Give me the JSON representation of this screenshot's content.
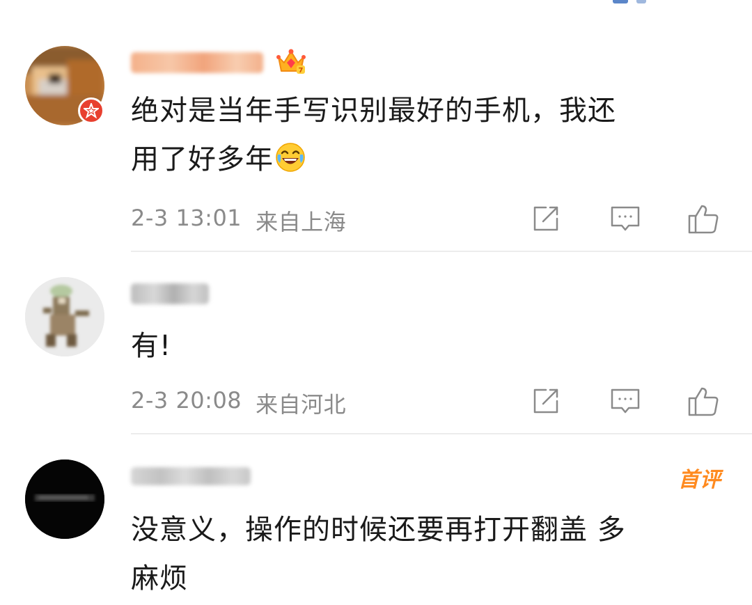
{
  "colors": {
    "text_primary": "#1a1a1a",
    "text_secondary": "#8a8a8a",
    "vip_red": "#e8402f",
    "first_comment_tag": "#ff8a1f",
    "divider": "#ececec"
  },
  "comments": [
    {
      "username": "",
      "username_hidden_note": "",
      "has_vip_crown": true,
      "text_line1": "绝对是当年手写识别最好的手机，我还",
      "text_line2": "用了好多年",
      "emoji": "laughing-crying-emoji",
      "time": "2-3 13:01",
      "location": "来自上海"
    },
    {
      "username": "",
      "text_line1": "有!",
      "time": "2-3 20:08",
      "location": "来自河北"
    },
    {
      "username": "",
      "tag": "首评",
      "text_line1": "没意义，操作的时候还要再打开翻盖 多",
      "text_line2": "麻烦"
    }
  ]
}
